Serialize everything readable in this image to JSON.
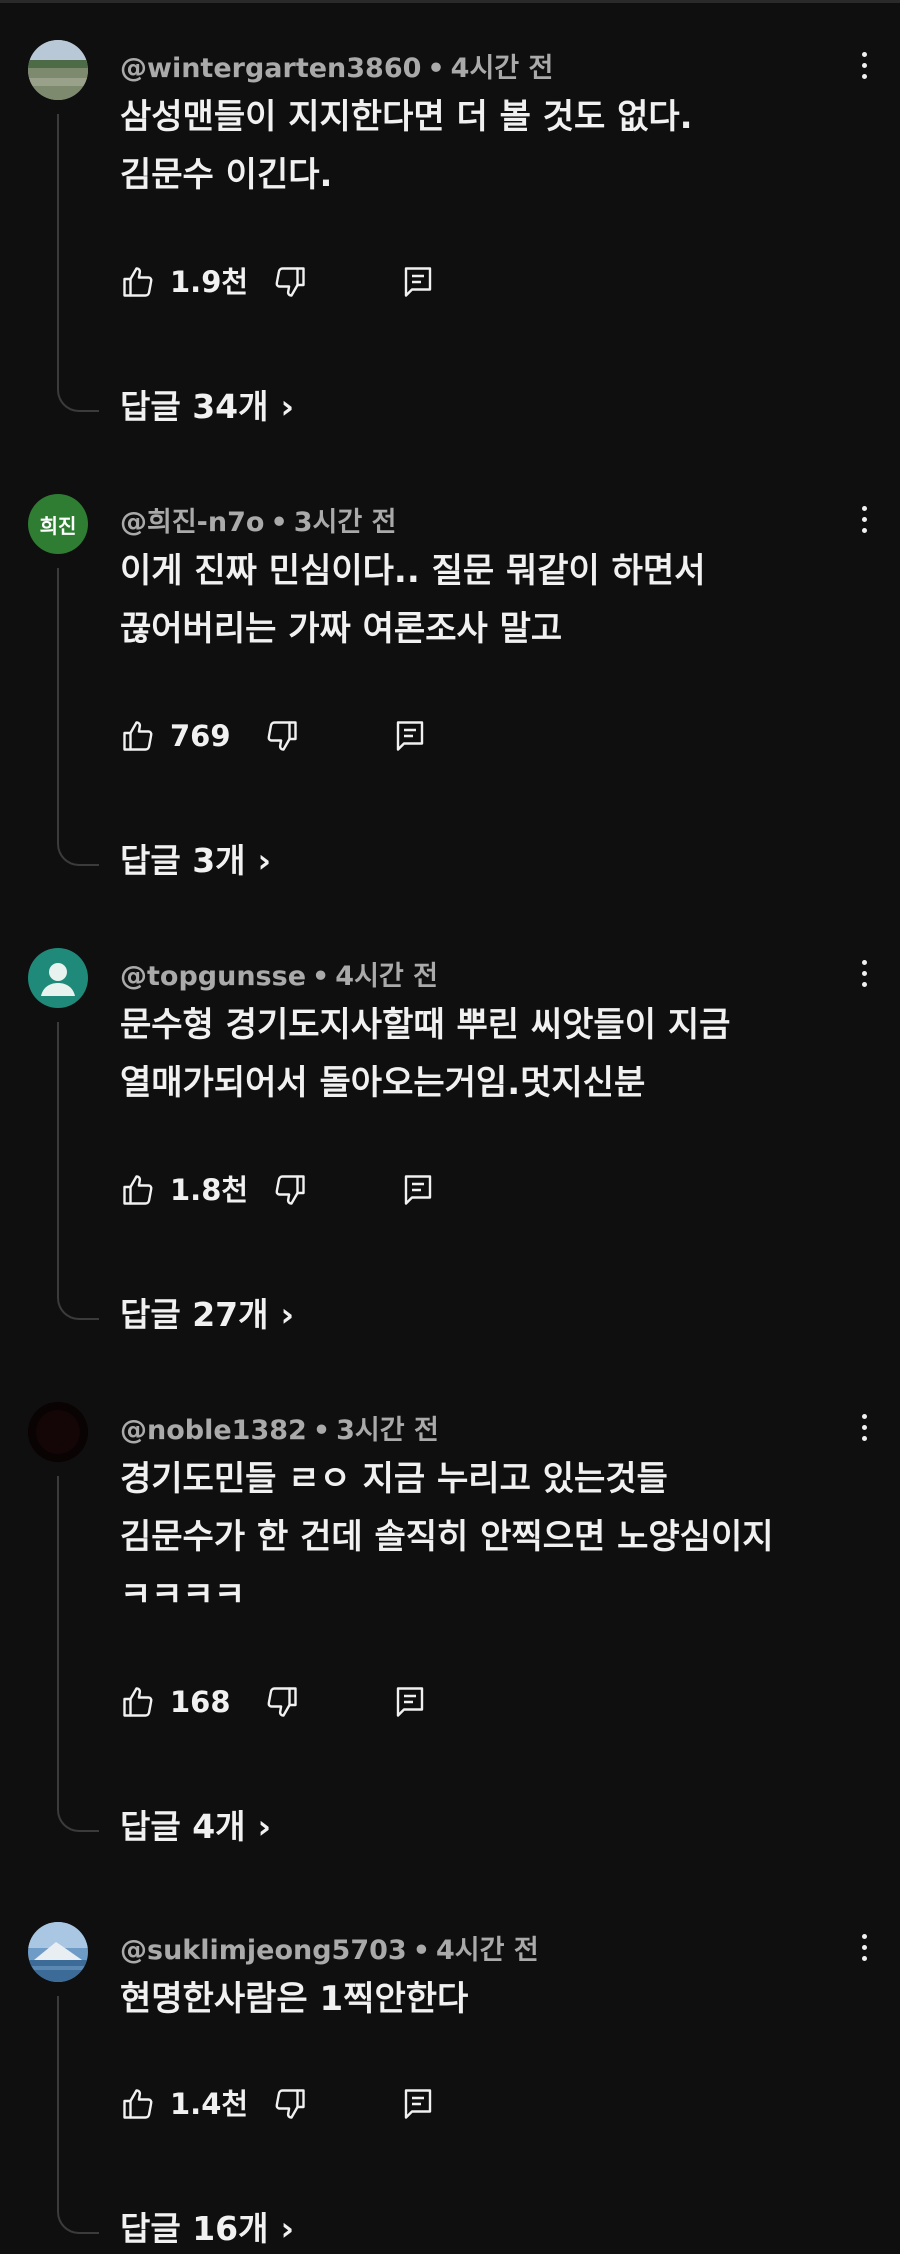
{
  "comments": [
    {
      "handle": "@wintergarten3860",
      "separator": "•",
      "time": "4시간 전",
      "lines": [
        "삼성맨들이 지지한다면 더 볼 것도 없다.",
        "김문수 이긴다."
      ],
      "likes": "1.9천",
      "replies": "답글 34개",
      "avatar": "landscape-photo"
    },
    {
      "handle": "@희진-n7o",
      "separator": "•",
      "time": "3시간 전",
      "lines": [
        "이게 진짜 민심이다.. 질문 뭐같이 하면서",
        "끊어버리는 가짜 여론조사 말고"
      ],
      "likes": "769",
      "replies": "답글 3개",
      "avatar_text": "희진",
      "avatar_color": "#2e7d32"
    },
    {
      "handle": "@topgunsse",
      "separator": "•",
      "time": "4시간 전",
      "lines": [
        "문수형 경기도지사할때 뿌린 씨앗들이 지금",
        "열매가되어서 돌아오는거임.멋지신분"
      ],
      "likes": "1.8천",
      "replies": "답글 27개",
      "avatar": "default-person",
      "avatar_color": "#1f8a79"
    },
    {
      "handle": "@noble1382",
      "separator": "•",
      "time": "3시간 전",
      "lines": [
        "경기도민들 ㄹㅇ 지금 누리고 있는것들",
        "김문수가 한 건데 솔직히 안찍으면 노양심이지",
        "ㅋㅋㅋㅋ"
      ],
      "likes": "168",
      "replies": "답글 4개",
      "avatar": "dark-photo"
    },
    {
      "handle": "@suklimjeong5703",
      "separator": "•",
      "time": "4시간 전",
      "lines": [
        "현명한사람은 1찍안한다"
      ],
      "likes": "1.4천",
      "replies": "답글 16개",
      "avatar": "mountain-photo"
    }
  ],
  "icons": {
    "like": "thumbs-up-icon",
    "dislike": "thumbs-down-icon",
    "reply": "comment-reply-icon",
    "more": "more-vertical-icon",
    "chevron": "chevron-right-icon"
  },
  "chevron_glyph": "›",
  "colors": {
    "background": "#0f0f0f",
    "text": "#f1f1f1",
    "meta": "#aaaaaa",
    "thread": "#3b3b3b"
  }
}
